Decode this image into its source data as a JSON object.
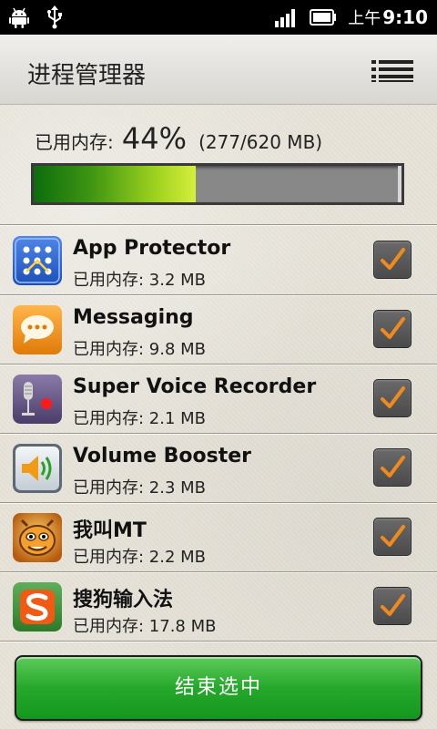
{
  "status_bar": {
    "ampm": "上午",
    "time": "9:10",
    "icons": [
      "android-icon",
      "usb-icon",
      "signal-icon",
      "battery-icon"
    ]
  },
  "header": {
    "title": "进程管理器",
    "menu_icon": "menu-list-icon"
  },
  "memory": {
    "label": "已用内存:",
    "percent_text": "44%",
    "percent_value": 44,
    "detail": "(277/620 MB)"
  },
  "processes": [
    {
      "name": "App Protector",
      "mem": "已用内存: 3.2 MB",
      "icon": "app-protector-icon",
      "checked": true
    },
    {
      "name": "Messaging",
      "mem": "已用内存: 9.8 MB",
      "icon": "messaging-icon",
      "checked": true
    },
    {
      "name": "Super Voice Recorder",
      "mem": "已用内存: 2.1 MB",
      "icon": "voice-recorder-icon",
      "checked": true
    },
    {
      "name": "Volume Booster",
      "mem": "已用内存: 2.3 MB",
      "icon": "volume-booster-icon",
      "checked": true
    },
    {
      "name": "我叫MT",
      "mem": "已用内存: 2.2 MB",
      "icon": "mt-game-icon",
      "checked": true
    },
    {
      "name": "搜狗输入法",
      "mem": "已用内存: 17.8 MB",
      "icon": "sogou-input-icon",
      "checked": true
    }
  ],
  "actions": {
    "end_selected": "结束选中"
  },
  "colors": {
    "accent_green": "#25a82b",
    "check_orange": "#f08a1e",
    "memory_fill_start": "#0c6c0c",
    "memory_fill_end": "#d6ee3c"
  }
}
